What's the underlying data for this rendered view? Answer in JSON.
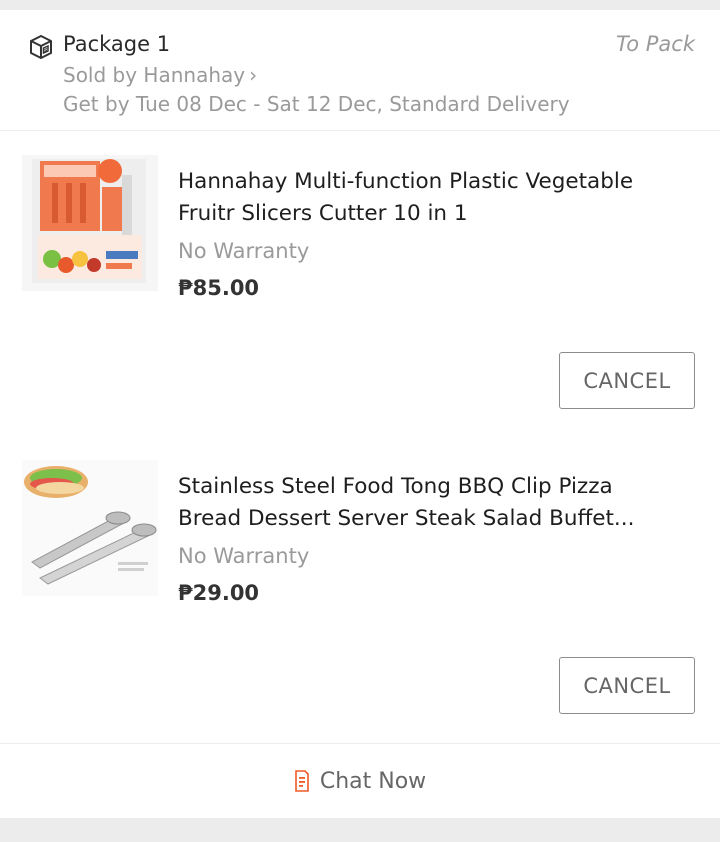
{
  "package": {
    "title": "Package 1",
    "status": "To Pack",
    "seller": "Sold by Hannahay",
    "delivery": "Get by Tue 08 Dec - Sat 12 Dec, Standard Delivery",
    "icon": "package-box-icon"
  },
  "items": [
    {
      "name_line1": "Hannahay Multi-function Plastic Vegetable",
      "name_line2": "Fruitr Slicers Cutter 10 in 1",
      "warranty": "No Warranty",
      "price": "₱85.00",
      "cancel_label": "CANCEL",
      "thumb_icon": "vegetable-slicer-product-image"
    },
    {
      "name_line1": "Stainless Steel Food Tong BBQ Clip Pizza",
      "name_line2": "Bread Dessert Server Steak Salad Buffet...",
      "warranty": "No Warranty",
      "price": "₱29.00",
      "cancel_label": "CANCEL",
      "thumb_icon": "food-tong-product-image"
    }
  ],
  "chat": {
    "label": "Chat Now",
    "icon": "chat-store-icon"
  },
  "colors": {
    "accent": "#f05a28",
    "muted_text": "#9a9a9a",
    "divider": "#ececec"
  }
}
